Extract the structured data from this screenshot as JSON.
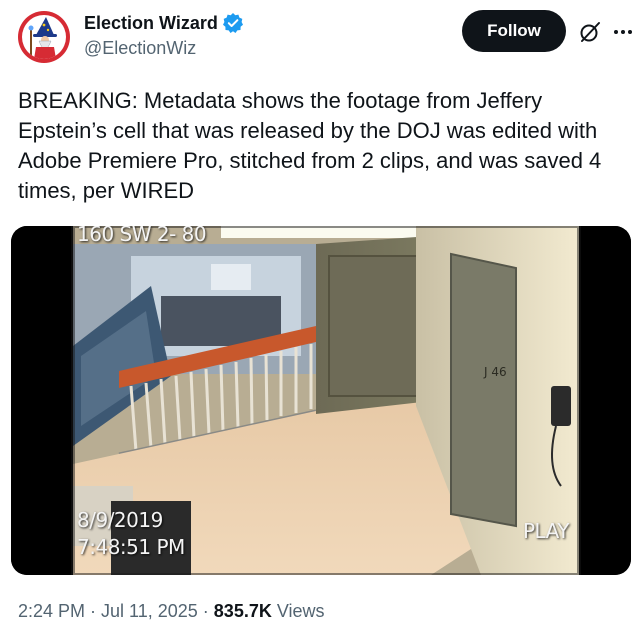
{
  "author": {
    "display_name": "Election Wizard",
    "handle": "@ElectionWiz",
    "verified": true
  },
  "actions": {
    "follow_label": "Follow",
    "grok_icon": "grok-icon",
    "more_icon": "more-icon"
  },
  "tweet": {
    "text": "BREAKING: Metadata shows the footage from Jeffery Epstein’s cell that was released by the DOJ was edited with Adobe Premiere Pro, stitched from 2 clips, and was saved 4 times, per WIRED"
  },
  "media": {
    "camera_label": "160 SW 2- 80",
    "date": "8/9/2019",
    "time": "7:48:51 PM",
    "play_label": "PLAY",
    "door_number": "J 46"
  },
  "meta": {
    "time": "2:24 PM",
    "separator": " · ",
    "date": "Jul 11, 2025",
    "views_count": "835.7K",
    "views_label": " Views"
  },
  "colors": {
    "text_primary": "#0f1419",
    "text_secondary": "#536471",
    "verified_blue": "#1d9bf0",
    "follow_bg": "#0f1419",
    "avatar_red": "#d62b34"
  }
}
